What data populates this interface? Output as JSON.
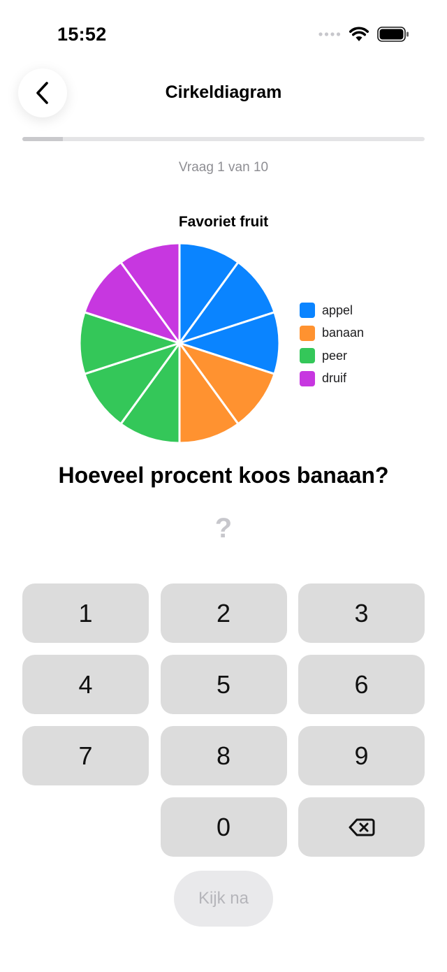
{
  "status_bar": {
    "time": "15:52",
    "icons": [
      "signal-dots-icon",
      "wifi-icon",
      "battery-icon"
    ]
  },
  "nav": {
    "back_icon": "chevron-left-icon",
    "title": "Cirkeldiagram"
  },
  "progress": {
    "fraction": 0.1
  },
  "question_counter": "Vraag 1 van 10",
  "chart_data": {
    "type": "pie",
    "title": "Favoriet fruit",
    "categories": [
      "appel",
      "banaan",
      "peer",
      "druif"
    ],
    "values": [
      30,
      20,
      30,
      20
    ],
    "colors": [
      "#0a84ff",
      "#ff9230",
      "#34c759",
      "#c737e0"
    ],
    "legend_position": "right",
    "segment_divisions": 10
  },
  "question": "Hoeveel procent koos banaan?",
  "answer_placeholder": "?",
  "keypad": {
    "keys": [
      "1",
      "2",
      "3",
      "4",
      "5",
      "6",
      "7",
      "8",
      "9",
      "",
      "0",
      "backspace"
    ],
    "backspace_icon": "backspace-icon"
  },
  "check_button_label": "Kijk na"
}
